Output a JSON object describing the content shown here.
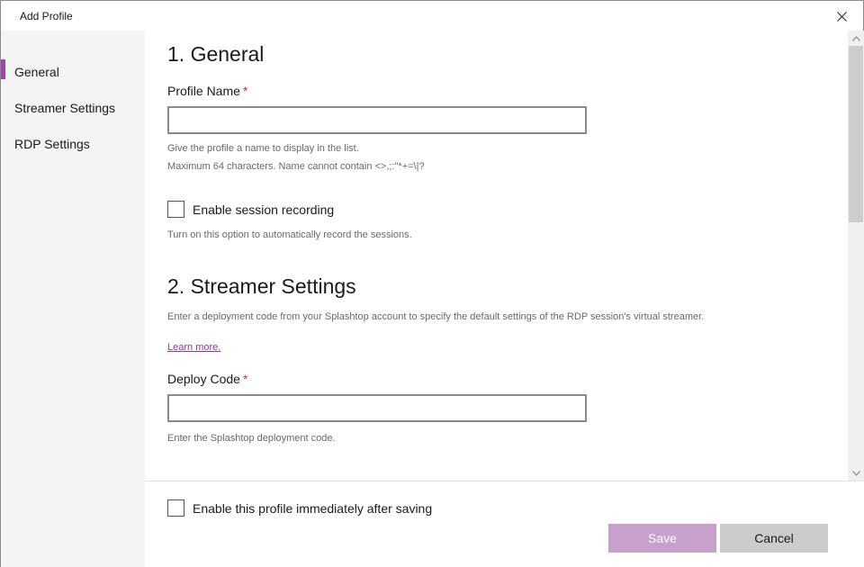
{
  "window": {
    "title": "Add Profile"
  },
  "sidebar": {
    "items": [
      {
        "label": "General"
      },
      {
        "label": "Streamer Settings"
      },
      {
        "label": "RDP Settings"
      }
    ]
  },
  "general": {
    "heading": "1. General",
    "profile_name_label": "Profile Name",
    "required_mark": "*",
    "profile_name_value": "",
    "profile_name_hint1": "Give the profile a name to display in the list.",
    "profile_name_hint2": "Maximum 64 characters. Name cannot contain <>,;:\"*+=\\|?",
    "session_recording_label": "Enable session recording",
    "session_recording_hint": "Turn on this option to automatically record the sessions."
  },
  "streamer": {
    "heading": "2. Streamer Settings",
    "description": "Enter a deployment code from your Splashtop account to specify the default settings of the RDP session's virtual streamer.",
    "learn_more": "Learn more.",
    "deploy_code_label": "Deploy Code",
    "required_mark": "*",
    "deploy_code_value": "",
    "deploy_code_hint": "Enter the Splashtop deployment code."
  },
  "footer": {
    "enable_profile_label": "Enable this profile immediately after saving",
    "save_label": "Save",
    "cancel_label": "Cancel"
  },
  "colors": {
    "accent": "#9b47a8",
    "save_button_bg": "#c8a0cc",
    "cancel_button_bg": "#cccccc",
    "link": "#8a3b95",
    "required": "#d32f2f"
  },
  "icons": {
    "close": "close-icon",
    "scroll_up": "chevron-up-icon",
    "scroll_down": "chevron-down-icon"
  }
}
